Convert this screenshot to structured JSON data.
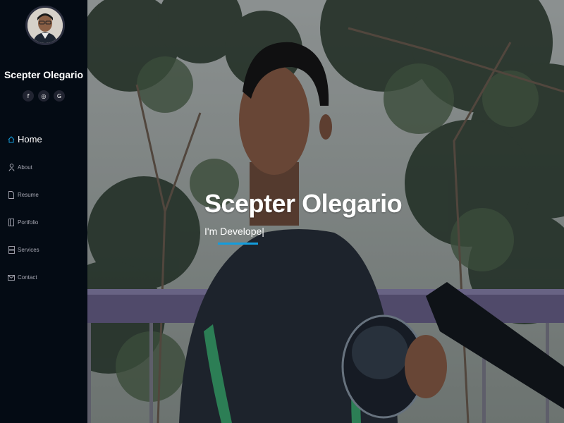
{
  "profile": {
    "name": "Scepter Olegario",
    "photo_alt": "profile photo"
  },
  "social": [
    {
      "name": "facebook",
      "glyph": "f"
    },
    {
      "name": "instagram",
      "glyph": "◎"
    },
    {
      "name": "google",
      "glyph": "G"
    }
  ],
  "nav": [
    {
      "label": "Home",
      "icon": "home-icon",
      "active": true
    },
    {
      "label": "About",
      "icon": "person-icon"
    },
    {
      "label": "Resume",
      "icon": "file-icon"
    },
    {
      "label": "Portfolio",
      "icon": "book-icon"
    },
    {
      "label": "Services",
      "icon": "server-icon"
    },
    {
      "label": "Contact",
      "icon": "envelope-icon"
    }
  ],
  "hero": {
    "title": "Scepter Olegario",
    "subtitle": "I'm Develope|"
  },
  "colors": {
    "accent": "#149ddd",
    "sidebar_bg": "#040b14",
    "nav_text": "#a8a9b4"
  }
}
